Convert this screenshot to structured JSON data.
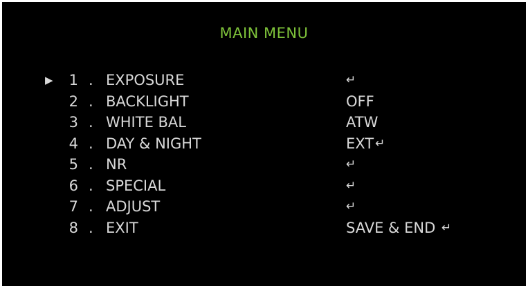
{
  "colors": {
    "background": "#000000",
    "title": "#7ec23a",
    "text": "#d8d8d8",
    "border": "#ffffff"
  },
  "menu": {
    "title": "MAIN MENU",
    "cursor": "▶",
    "separator": ".",
    "enter_glyph": "↵",
    "items": [
      {
        "num": "1",
        "label": "EXPOSURE",
        "value": "",
        "enter": true,
        "selected": true
      },
      {
        "num": "2",
        "label": "BACKLIGHT",
        "value": "OFF",
        "enter": false,
        "selected": false
      },
      {
        "num": "3",
        "label": "WHITE BAL",
        "value": "ATW",
        "enter": false,
        "selected": false
      },
      {
        "num": "4",
        "label": "DAY & NIGHT",
        "value": "EXT",
        "enter": true,
        "selected": false
      },
      {
        "num": "5",
        "label": "NR",
        "value": "",
        "enter": true,
        "selected": false
      },
      {
        "num": "6",
        "label": "SPECIAL",
        "value": "",
        "enter": true,
        "selected": false
      },
      {
        "num": "7",
        "label": "ADJUST",
        "value": "",
        "enter": true,
        "selected": false
      },
      {
        "num": "8",
        "label": "EXIT",
        "value": "SAVE & END",
        "enter": true,
        "selected": false
      }
    ]
  }
}
